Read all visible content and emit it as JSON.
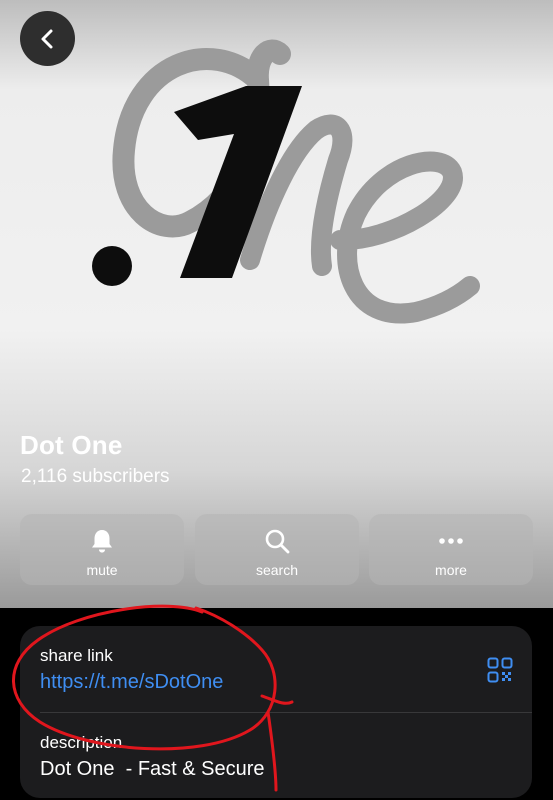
{
  "header": {
    "back_icon": "chevron-left-icon"
  },
  "channel": {
    "title": "Dot One",
    "subscribers": "2,116 subscribers"
  },
  "actions": [
    {
      "label": "mute",
      "icon": "bell-icon"
    },
    {
      "label": "search",
      "icon": "search-icon"
    },
    {
      "label": "more",
      "icon": "more-dots-icon"
    }
  ],
  "info": {
    "share_link_label": "share link",
    "share_link": "https://t.me/sDotOne",
    "qr_icon": "qr-code-icon",
    "description_label": "description",
    "description": "Dot One  - Fast & Secure"
  },
  "colors": {
    "link": "#3f8ef2",
    "card_background": "#1c1c1e",
    "annotation_stroke": "#e0161d"
  }
}
